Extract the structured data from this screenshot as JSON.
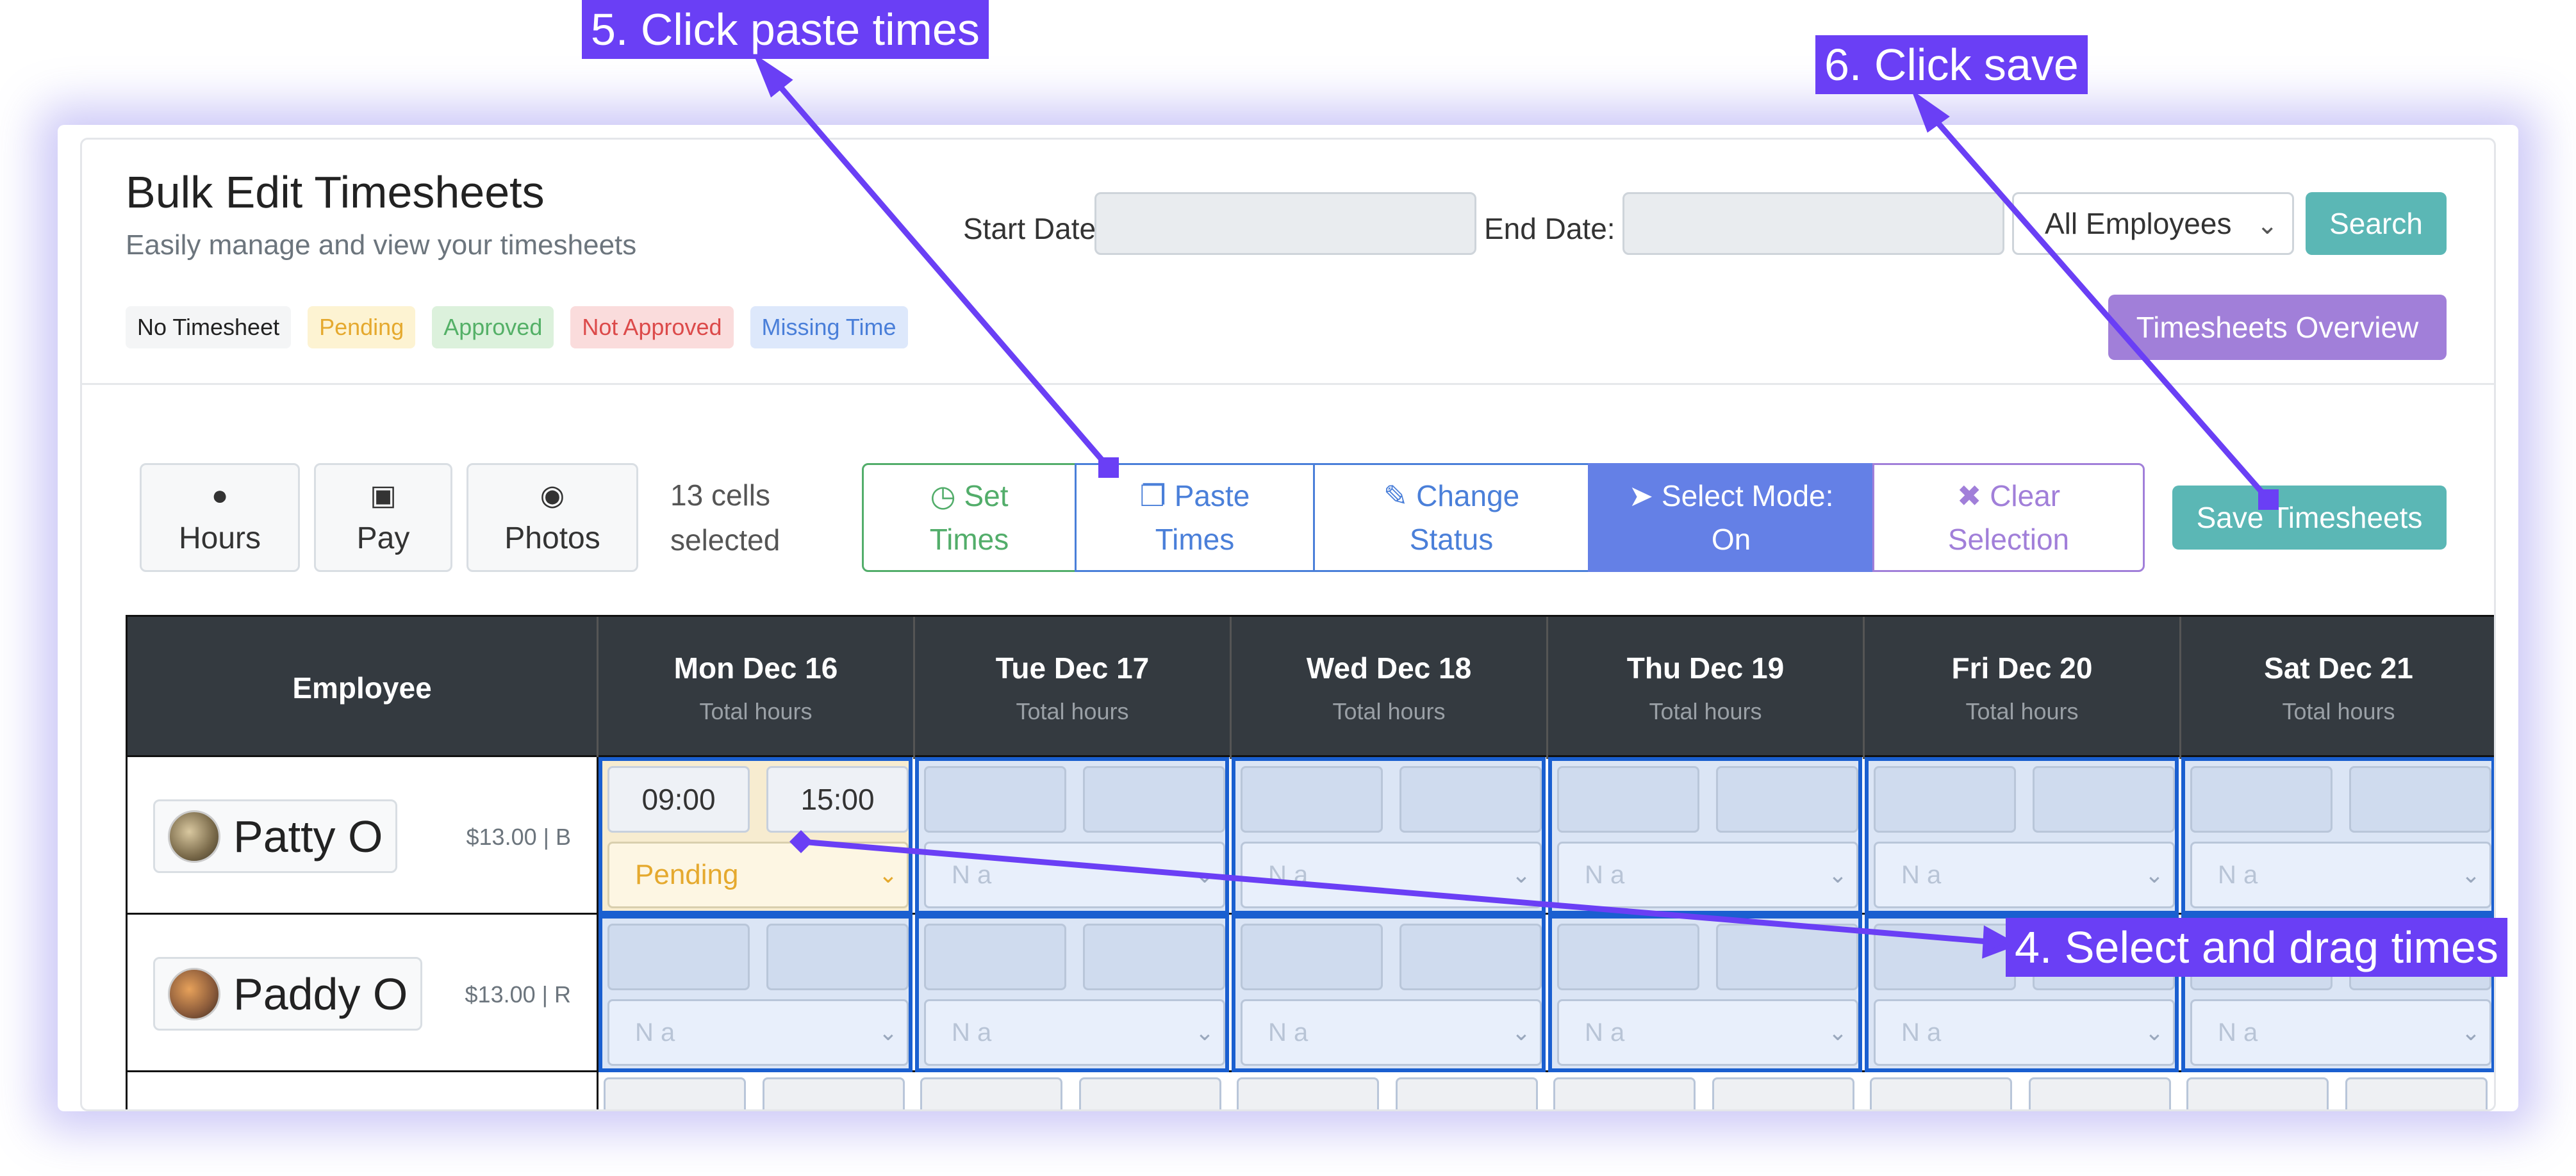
{
  "header": {
    "title": "Bulk Edit Timesheets",
    "subtitle": "Easily manage and view your timesheets"
  },
  "legend": [
    "No Timesheet",
    "Pending",
    "Approved",
    "Not Approved",
    "Missing Time"
  ],
  "filters": {
    "start_label": "Start Date:",
    "end_label": "End Date:",
    "start_value": "",
    "end_value": "",
    "employee_select": "All Employees",
    "search_label": "Search"
  },
  "overview_label": "Timesheets Overview",
  "modes": {
    "hours": "Hours",
    "pay": "Pay",
    "photos": "Photos"
  },
  "cells_selected": {
    "line1": "13 cells",
    "line2": "selected"
  },
  "actions": {
    "set_times_1": "Set",
    "set_times_2": "Times",
    "paste_1": "Paste",
    "paste_2": "Times",
    "change_1": "Change",
    "change_2": "Status",
    "select_1": "Select Mode:",
    "select_2": "On",
    "clear_1": "Clear",
    "clear_2": "Selection"
  },
  "save_label": "Save Timesheets",
  "table": {
    "employee_header": "Employee",
    "days": [
      {
        "day": "Mon Dec 16",
        "sub": "Total hours"
      },
      {
        "day": "Tue Dec 17",
        "sub": "Total hours"
      },
      {
        "day": "Wed Dec 18",
        "sub": "Total hours"
      },
      {
        "day": "Thu Dec 19",
        "sub": "Total hours"
      },
      {
        "day": "Fri Dec 20",
        "sub": "Total hours"
      },
      {
        "day": "Sat Dec 21",
        "sub": "Total hours"
      }
    ],
    "rows": [
      {
        "name": "Patty O",
        "rate": "$13.00 | B",
        "first_cell": {
          "start": "09:00",
          "end": "15:00",
          "status": "Pending"
        },
        "placeholder": "N a"
      },
      {
        "name": "Paddy O",
        "rate": "$13.00 | R",
        "placeholder": "N a"
      }
    ]
  },
  "callouts": {
    "paste": "5. Click paste times",
    "save": "6. Click save",
    "drag": "4. Select and drag times"
  },
  "colors": {
    "accent": "#6a3ff5",
    "teal": "#5bb7b5",
    "purple": "#a17fd9",
    "select_mode": "#6480e6"
  }
}
